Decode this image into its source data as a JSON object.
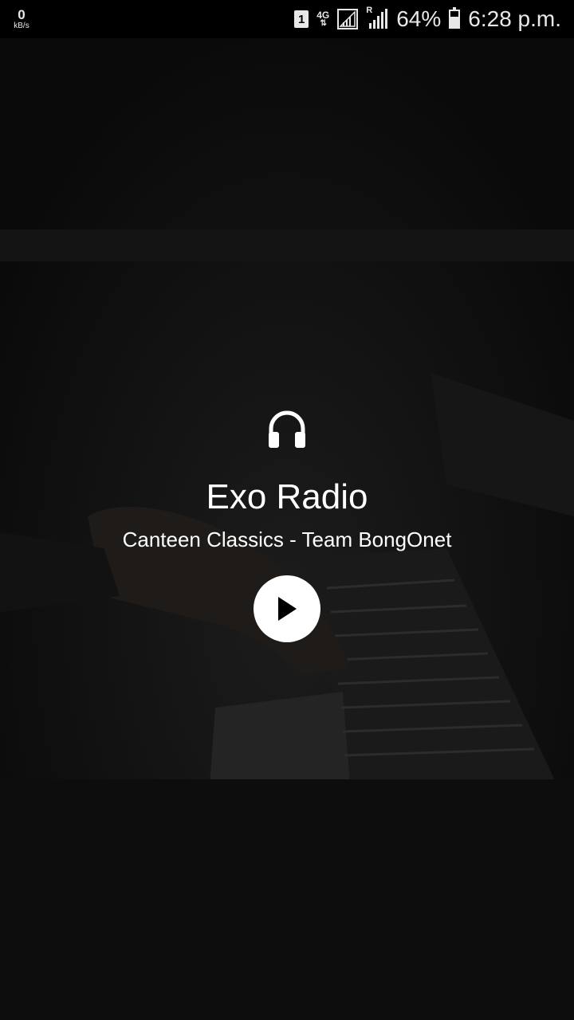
{
  "status_bar": {
    "net_speed_value": "0",
    "net_speed_unit": "kB/s",
    "sim_slot": "1",
    "network_type": "4G",
    "roaming_indicator": "R",
    "battery_percent": "64%",
    "time": "6:28 p.m."
  },
  "player": {
    "icon": "headphones-icon",
    "station_name": "Exo Radio",
    "now_playing": "Canteen Classics - Team BongOnet",
    "play_icon": "play-icon"
  },
  "colors": {
    "background": "#0c0c0c",
    "text": "#ffffff",
    "play_button": "#ffffff"
  }
}
